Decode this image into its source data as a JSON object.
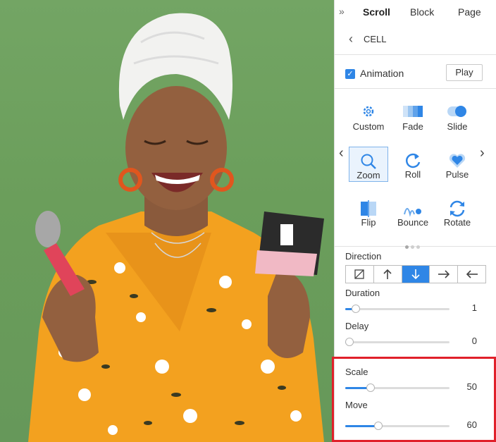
{
  "tabs": {
    "collapse_glyph": "»",
    "scroll": "Scroll",
    "block": "Block",
    "page": "Page"
  },
  "breadcrumb": {
    "back_glyph": "‹",
    "label": "CELL"
  },
  "animation": {
    "checked": true,
    "check_glyph": "✓",
    "label": "Animation",
    "play_label": "Play"
  },
  "effects": {
    "prev_glyph": "‹",
    "next_glyph": "›",
    "items": [
      {
        "label": "Custom",
        "icon": "gear-icon"
      },
      {
        "label": "Fade",
        "icon": "fade-icon"
      },
      {
        "label": "Slide",
        "icon": "slide-icon"
      },
      {
        "label": "Zoom",
        "icon": "zoom-icon",
        "selected": true
      },
      {
        "label": "Roll",
        "icon": "roll-icon"
      },
      {
        "label": "Pulse",
        "icon": "heart-icon"
      },
      {
        "label": "Flip",
        "icon": "flip-icon"
      },
      {
        "label": "Bounce",
        "icon": "bounce-icon"
      },
      {
        "label": "Rotate",
        "icon": "rotate-icon"
      }
    ],
    "page_count": 3,
    "current_page": 1
  },
  "direction": {
    "label": "Direction",
    "options": [
      "none",
      "up",
      "down",
      "right",
      "left"
    ],
    "selected": "down"
  },
  "duration": {
    "label": "Duration",
    "value": "1",
    "fraction": 0.1
  },
  "delay": {
    "label": "Delay",
    "value": "0",
    "fraction": 0.0
  },
  "scale": {
    "label": "Scale",
    "value": "50",
    "fraction": 0.24
  },
  "move": {
    "label": "Move",
    "value": "60",
    "fraction": 0.32
  },
  "colors": {
    "accent": "#2f86e6",
    "highlight": "#e0202a",
    "background_green": "#6b9e5b",
    "dress_orange": "#f2a21e"
  }
}
